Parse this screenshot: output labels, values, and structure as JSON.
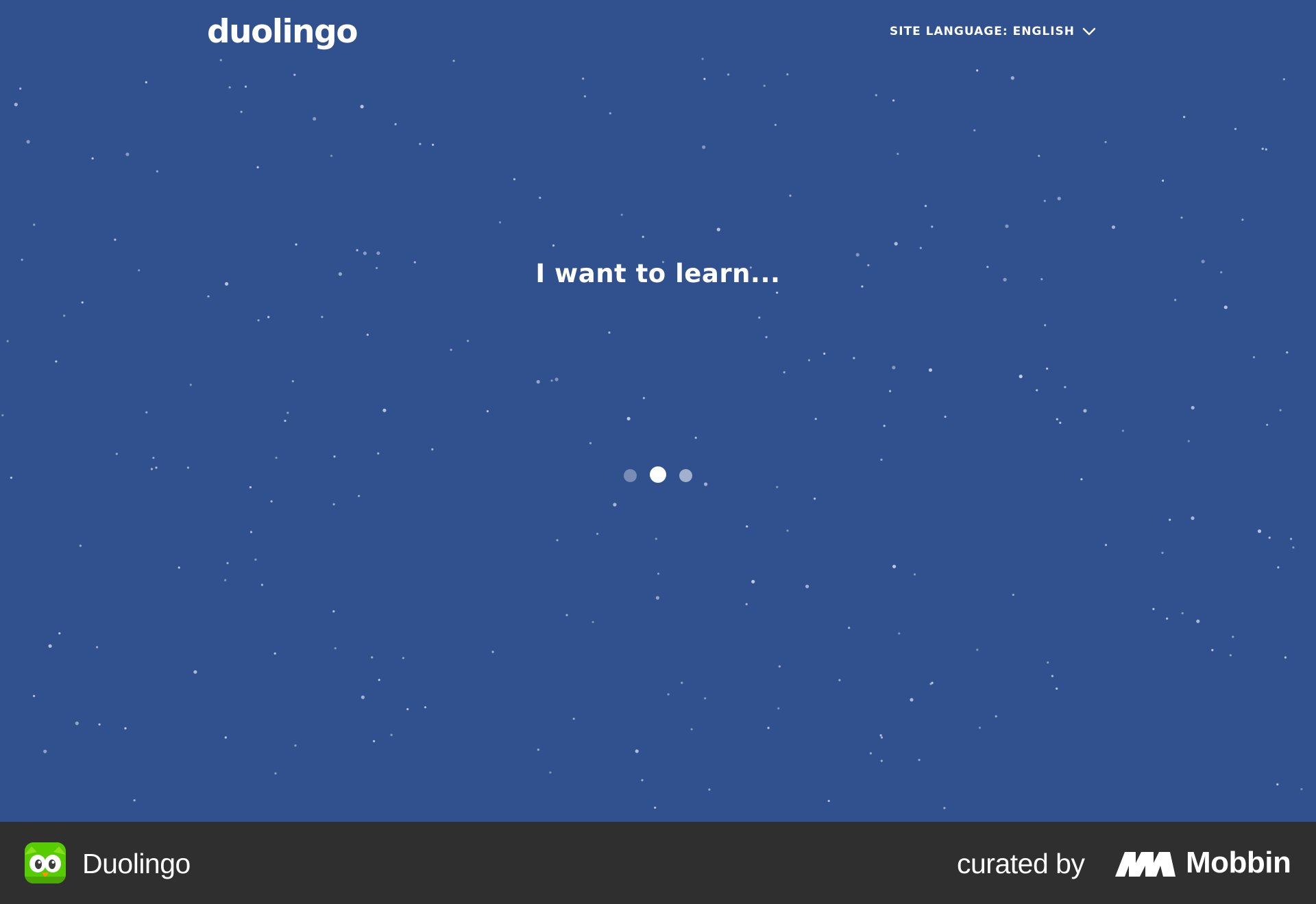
{
  "header": {
    "logo_text": "duolingo",
    "site_language_label": "SITE LANGUAGE: ENGLISH",
    "site_language_icon": "chevron-down-icon"
  },
  "main": {
    "heading": "I want to learn...",
    "loading_indicator": {
      "dot_count": 3,
      "active_dot": 2
    }
  },
  "footer": {
    "app_name": "Duolingo",
    "app_icon": "duolingo-owl-icon",
    "curated_by_label": "curated by",
    "curator_name": "Mobbin",
    "curator_icon": "mobbin-logo-icon"
  },
  "colors": {
    "background": "#30518e",
    "text": "#ffffff",
    "footer_background": "#2f2f2f",
    "brand_green": "#58cc02"
  }
}
